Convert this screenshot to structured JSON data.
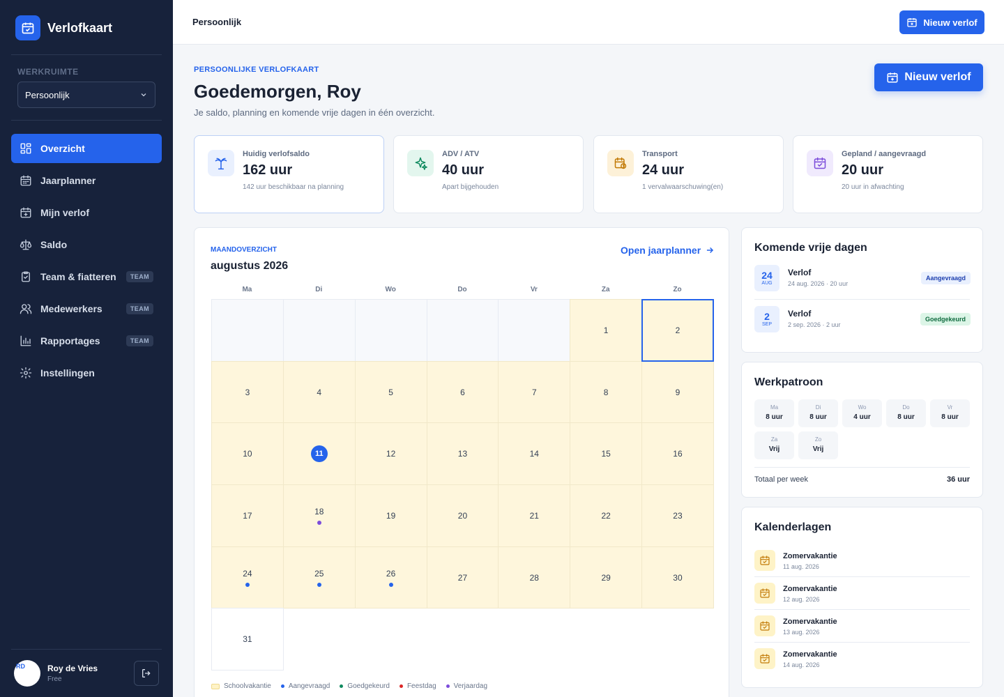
{
  "brand": {
    "name": "Verlofkaart"
  },
  "workspace": {
    "label": "WERKRUIMTE",
    "selected": "Persoonlijk"
  },
  "nav": [
    {
      "label": "Overzicht",
      "icon": "grid-icon",
      "active": true,
      "badge": ""
    },
    {
      "label": "Jaarplanner",
      "icon": "calendar-icon",
      "active": false,
      "badge": ""
    },
    {
      "label": "Mijn verlof",
      "icon": "calendar-plus-icon",
      "active": false,
      "badge": ""
    },
    {
      "label": "Saldo",
      "icon": "scale-icon",
      "active": false,
      "badge": ""
    },
    {
      "label": "Team & fiatteren",
      "icon": "clipboard-check-icon",
      "active": false,
      "badge": "TEAM"
    },
    {
      "label": "Medewerkers",
      "icon": "users-icon",
      "active": false,
      "badge": "TEAM"
    },
    {
      "label": "Rapportages",
      "icon": "bar-chart-icon",
      "active": false,
      "badge": "TEAM"
    },
    {
      "label": "Instellingen",
      "icon": "gear-icon",
      "active": false,
      "badge": ""
    }
  ],
  "user": {
    "initials": "RD",
    "name": "Roy de Vries",
    "plan": "Free"
  },
  "topbar": {
    "title": "Persoonlijk",
    "button": "Nieuw verlof"
  },
  "header": {
    "eyebrow": "PERSOONLIJKE VERLOFKAART",
    "greeting": "Goedemorgen, Roy",
    "subtitle": "Je saldo, planning en komende vrije dagen in één overzicht.",
    "button": "Nieuw verlof"
  },
  "stats": [
    {
      "label": "Huidig verlofsaldo",
      "value": "162 uur",
      "note": "142 uur beschikbaar na planning",
      "icon": "palm-tree-icon",
      "color": "#2563eb",
      "bg": "#e9f0fe"
    },
    {
      "label": "ADV / ATV",
      "value": "40 uur",
      "note": "Apart bijgehouden",
      "icon": "sparkle-icon",
      "color": "#0f8a5f",
      "bg": "#e3f6ee"
    },
    {
      "label": "Transport",
      "value": "24 uur",
      "note": "1 vervalwaarschuwing(en)",
      "icon": "calendar-clock-icon",
      "color": "#c27a06",
      "bg": "#fdf1d8"
    },
    {
      "label": "Gepland / aangevraagd",
      "value": "20 uur",
      "note": "20 uur in afwachting",
      "icon": "calendar-check-icon",
      "color": "#7c4ddb",
      "bg": "#f0eafd"
    }
  ],
  "calendar": {
    "eyebrow": "MAANDOVERZICHT",
    "month": "augustus 2026",
    "link": "Open jaarplanner",
    "weekdays": [
      "Ma",
      "Di",
      "Wo",
      "Do",
      "Vr",
      "Za",
      "Zo"
    ],
    "days": [
      {
        "n": ""
      },
      {
        "n": ""
      },
      {
        "n": ""
      },
      {
        "n": ""
      },
      {
        "n": ""
      },
      {
        "n": "1",
        "vac": true
      },
      {
        "n": "2",
        "vac": true,
        "selected": true
      },
      {
        "n": "3",
        "vac": true
      },
      {
        "n": "4",
        "vac": true
      },
      {
        "n": "5",
        "vac": true
      },
      {
        "n": "6",
        "vac": true
      },
      {
        "n": "7",
        "vac": true
      },
      {
        "n": "8",
        "vac": true
      },
      {
        "n": "9",
        "vac": true
      },
      {
        "n": "10",
        "vac": true
      },
      {
        "n": "11",
        "vac": true,
        "today": true
      },
      {
        "n": "12",
        "vac": true
      },
      {
        "n": "13",
        "vac": true
      },
      {
        "n": "14",
        "vac": true
      },
      {
        "n": "15",
        "vac": true
      },
      {
        "n": "16",
        "vac": true
      },
      {
        "n": "17",
        "vac": true
      },
      {
        "n": "18",
        "vac": true,
        "dot": "#7c4ddb"
      },
      {
        "n": "19",
        "vac": true
      },
      {
        "n": "20",
        "vac": true
      },
      {
        "n": "21",
        "vac": true
      },
      {
        "n": "22",
        "vac": true
      },
      {
        "n": "23",
        "vac": true
      },
      {
        "n": "24",
        "vac": true,
        "dot": "#2563eb"
      },
      {
        "n": "25",
        "vac": true,
        "dot": "#2563eb"
      },
      {
        "n": "26",
        "vac": true,
        "dot": "#2563eb"
      },
      {
        "n": "27",
        "vac": true
      },
      {
        "n": "28",
        "vac": true
      },
      {
        "n": "29",
        "vac": true
      },
      {
        "n": "30",
        "vac": true
      },
      {
        "n": "31"
      }
    ],
    "legend": [
      {
        "label": "Schoolvakantie",
        "type": "swatch",
        "color": "#fef3c7"
      },
      {
        "label": "Aangevraagd",
        "type": "dot",
        "color": "#2563eb"
      },
      {
        "label": "Goedgekeurd",
        "type": "dot",
        "color": "#0f8a5f"
      },
      {
        "label": "Feestdag",
        "type": "dot",
        "color": "#dc2626"
      },
      {
        "label": "Verjaardag",
        "type": "dot",
        "color": "#7c4ddb"
      }
    ]
  },
  "upcoming": {
    "title": "Komende vrije dagen",
    "items": [
      {
        "day": "24",
        "month": "AUG",
        "title": "Verlof",
        "sub": "24 aug. 2026 · 20 uur",
        "status": "Aangevraagd",
        "kind": "req"
      },
      {
        "day": "2",
        "month": "SEP",
        "title": "Verlof",
        "sub": "2 sep. 2026 · 2 uur",
        "status": "Goedgekeurd",
        "kind": "ok"
      }
    ]
  },
  "pattern": {
    "title": "Werkpatroon",
    "days": [
      {
        "d": "Ma",
        "h": "8 uur"
      },
      {
        "d": "Di",
        "h": "8 uur"
      },
      {
        "d": "Wo",
        "h": "4 uur"
      },
      {
        "d": "Do",
        "h": "8 uur"
      },
      {
        "d": "Vr",
        "h": "8 uur"
      },
      {
        "d": "Za",
        "h": "Vrij"
      },
      {
        "d": "Zo",
        "h": "Vrij"
      }
    ],
    "total_label": "Totaal per week",
    "total_value": "36 uur"
  },
  "layers": {
    "title": "Kalenderlagen",
    "items": [
      {
        "title": "Zomervakantie",
        "sub": "11 aug. 2026"
      },
      {
        "title": "Zomervakantie",
        "sub": "12 aug. 2026"
      },
      {
        "title": "Zomervakantie",
        "sub": "13 aug. 2026"
      },
      {
        "title": "Zomervakantie",
        "sub": "14 aug. 2026"
      }
    ]
  }
}
